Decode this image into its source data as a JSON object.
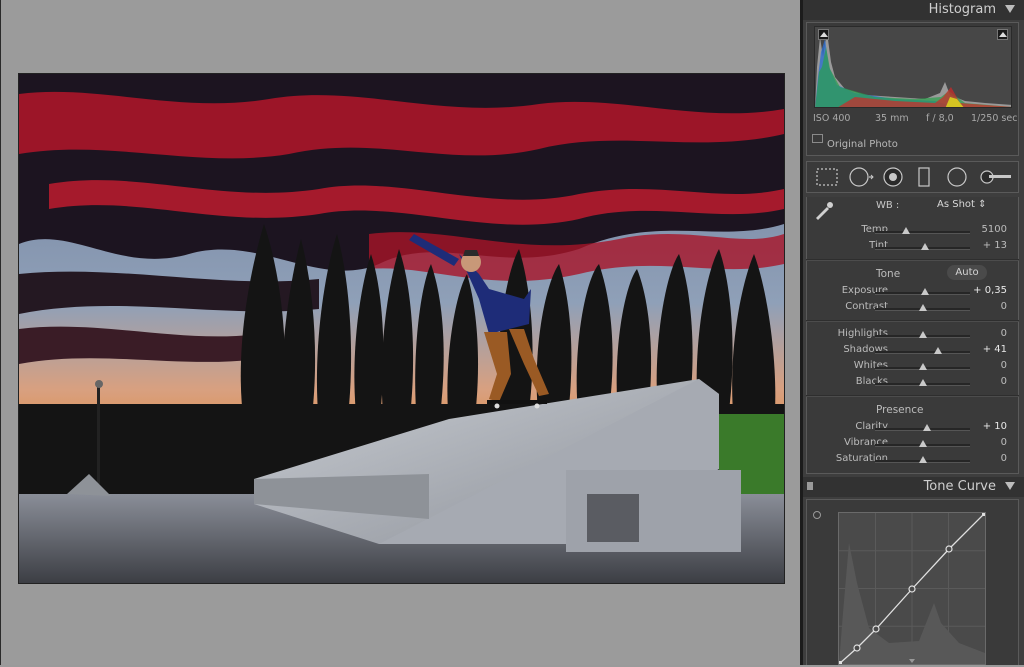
{
  "histogram": {
    "title": "Histogram",
    "exif": {
      "iso": "ISO 400",
      "focal": "35 mm",
      "aperture": "f / 8,0",
      "shutter": "1/250 sec"
    },
    "original_photo_label": "Original Photo"
  },
  "tools": [
    "crop-overlay-icon",
    "spot-removal-icon",
    "red-eye-icon",
    "graduated-filter-icon",
    "radial-filter-icon",
    "adjustment-brush-icon"
  ],
  "basic": {
    "wb_label": "WB :",
    "wb_value": "As Shot",
    "temp": {
      "label": "Temp",
      "value": "5100",
      "pos": 0.33
    },
    "tint": {
      "label": "Tint",
      "value": "+ 13",
      "pos": 0.53
    },
    "tone_label": "Tone",
    "auto_label": "Auto",
    "exposure": {
      "label": "Exposure",
      "value": "+ 0,35",
      "pos": 0.53
    },
    "contrast": {
      "label": "Contrast",
      "value": "0",
      "pos": 0.5
    },
    "highlights": {
      "label": "Highlights",
      "value": "0",
      "pos": 0.5
    },
    "shadows": {
      "label": "Shadows",
      "value": "+ 41",
      "pos": 0.66
    },
    "whites": {
      "label": "Whites",
      "value": "0",
      "pos": 0.5
    },
    "blacks": {
      "label": "Blacks",
      "value": "0",
      "pos": 0.5
    },
    "presence_label": "Presence",
    "clarity": {
      "label": "Clarity",
      "value": "+ 10",
      "pos": 0.55
    },
    "vibrance": {
      "label": "Vibrance",
      "value": "0",
      "pos": 0.5
    },
    "saturation": {
      "label": "Saturation",
      "value": "0",
      "pos": 0.5
    }
  },
  "tone_curve": {
    "title": "Tone Curve"
  },
  "colors": {
    "accent_clip": "#ffffff",
    "panel": "#3e3e3e",
    "header": "#323232"
  }
}
